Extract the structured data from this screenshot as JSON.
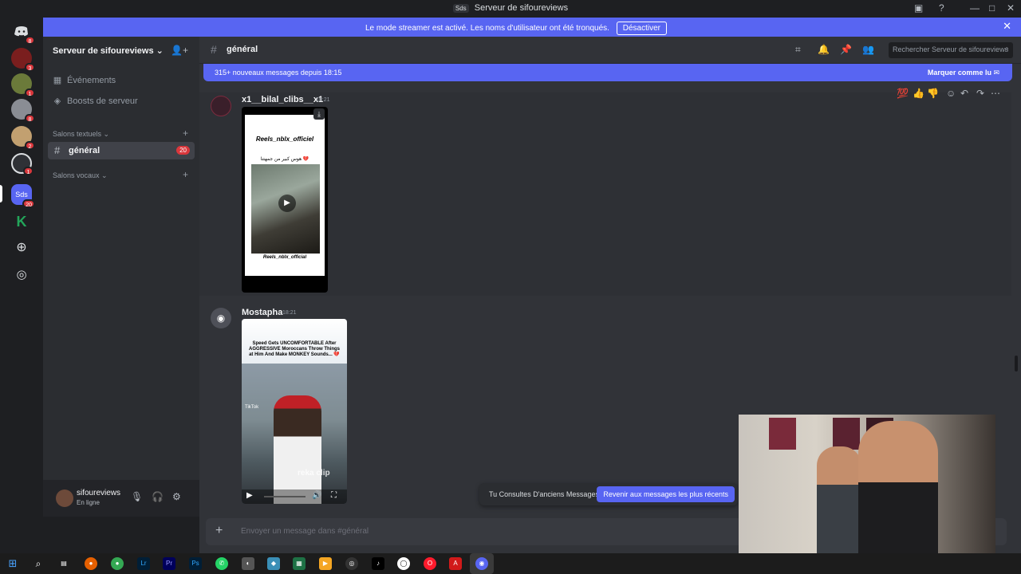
{
  "window": {
    "title": "Serveur de sifoureviews",
    "title_badge": "Sds",
    "controls": {
      "minimize": "—",
      "maximize": "□",
      "close": "✕"
    }
  },
  "streamer_banner": {
    "text": "Le mode streamer est activé. Les noms d'utilisateur ont été tronqués.",
    "button": "Désactiver"
  },
  "servers": [
    {
      "icon": "discord-icon",
      "badge": "8",
      "color": "#5865f2"
    },
    {
      "icon": "server-avatar",
      "badge": "3",
      "color": "#7a1e1e"
    },
    {
      "icon": "server-avatar",
      "badge": "1",
      "color": "#6b7a3a"
    },
    {
      "icon": "server-avatar",
      "badge": "8",
      "color": "#8a8d94"
    },
    {
      "icon": "server-avatar",
      "badge": "2",
      "color": "#c2a070"
    },
    {
      "icon": "server-avatar",
      "badge": "1",
      "color": "#2f3136"
    },
    {
      "icon": "server-avatar",
      "label": "Sds",
      "badge": "20",
      "color": "#5865f2"
    },
    {
      "icon": "server-avatar",
      "label": "K",
      "color": "#23a55a"
    }
  ],
  "sidebar": {
    "server_name": "Serveur de sifoureviews",
    "items": [
      {
        "label": "Événements",
        "icon": "calendar-icon"
      },
      {
        "label": "Boosts de serveur",
        "icon": "boost-icon"
      }
    ],
    "text_category": "Salons textuels",
    "voice_category": "Salons vocaux",
    "channel": {
      "name": "général",
      "unread": "20"
    }
  },
  "user": {
    "name": "sifoureviews",
    "status": "En ligne"
  },
  "header": {
    "channel": "général",
    "search_placeholder": "Rechercher Serveur de sifoureviews"
  },
  "new_messages": {
    "text": "315+ nouveaux messages depuis 18:15",
    "mark_read": "Marquer comme lu"
  },
  "messages": [
    {
      "author": "x1__bilal_clibs__x1",
      "time": "18:21",
      "video": {
        "top_text": "Reels_nblx_officiel",
        "arabic_text": "هوس كبير من جمهتنا 💔",
        "bottom_text": "Reels_nblx_official"
      }
    },
    {
      "author": "Mostapha",
      "time": "18:21",
      "video": {
        "caption": "Speed Gets UNCOMFORTABLE After AGGRESSIVE Moroccans Throw Things at Him And Make MONKEY Sounds... 💔",
        "tiktok": "TikTok",
        "watermark": "reka clip"
      }
    }
  ],
  "old_messages": {
    "text": "Tu Consultes D'anciens Messages",
    "jump": "Revenir aux messages les plus récents"
  },
  "composer": {
    "placeholder": "Envoyer un message dans #général"
  }
}
